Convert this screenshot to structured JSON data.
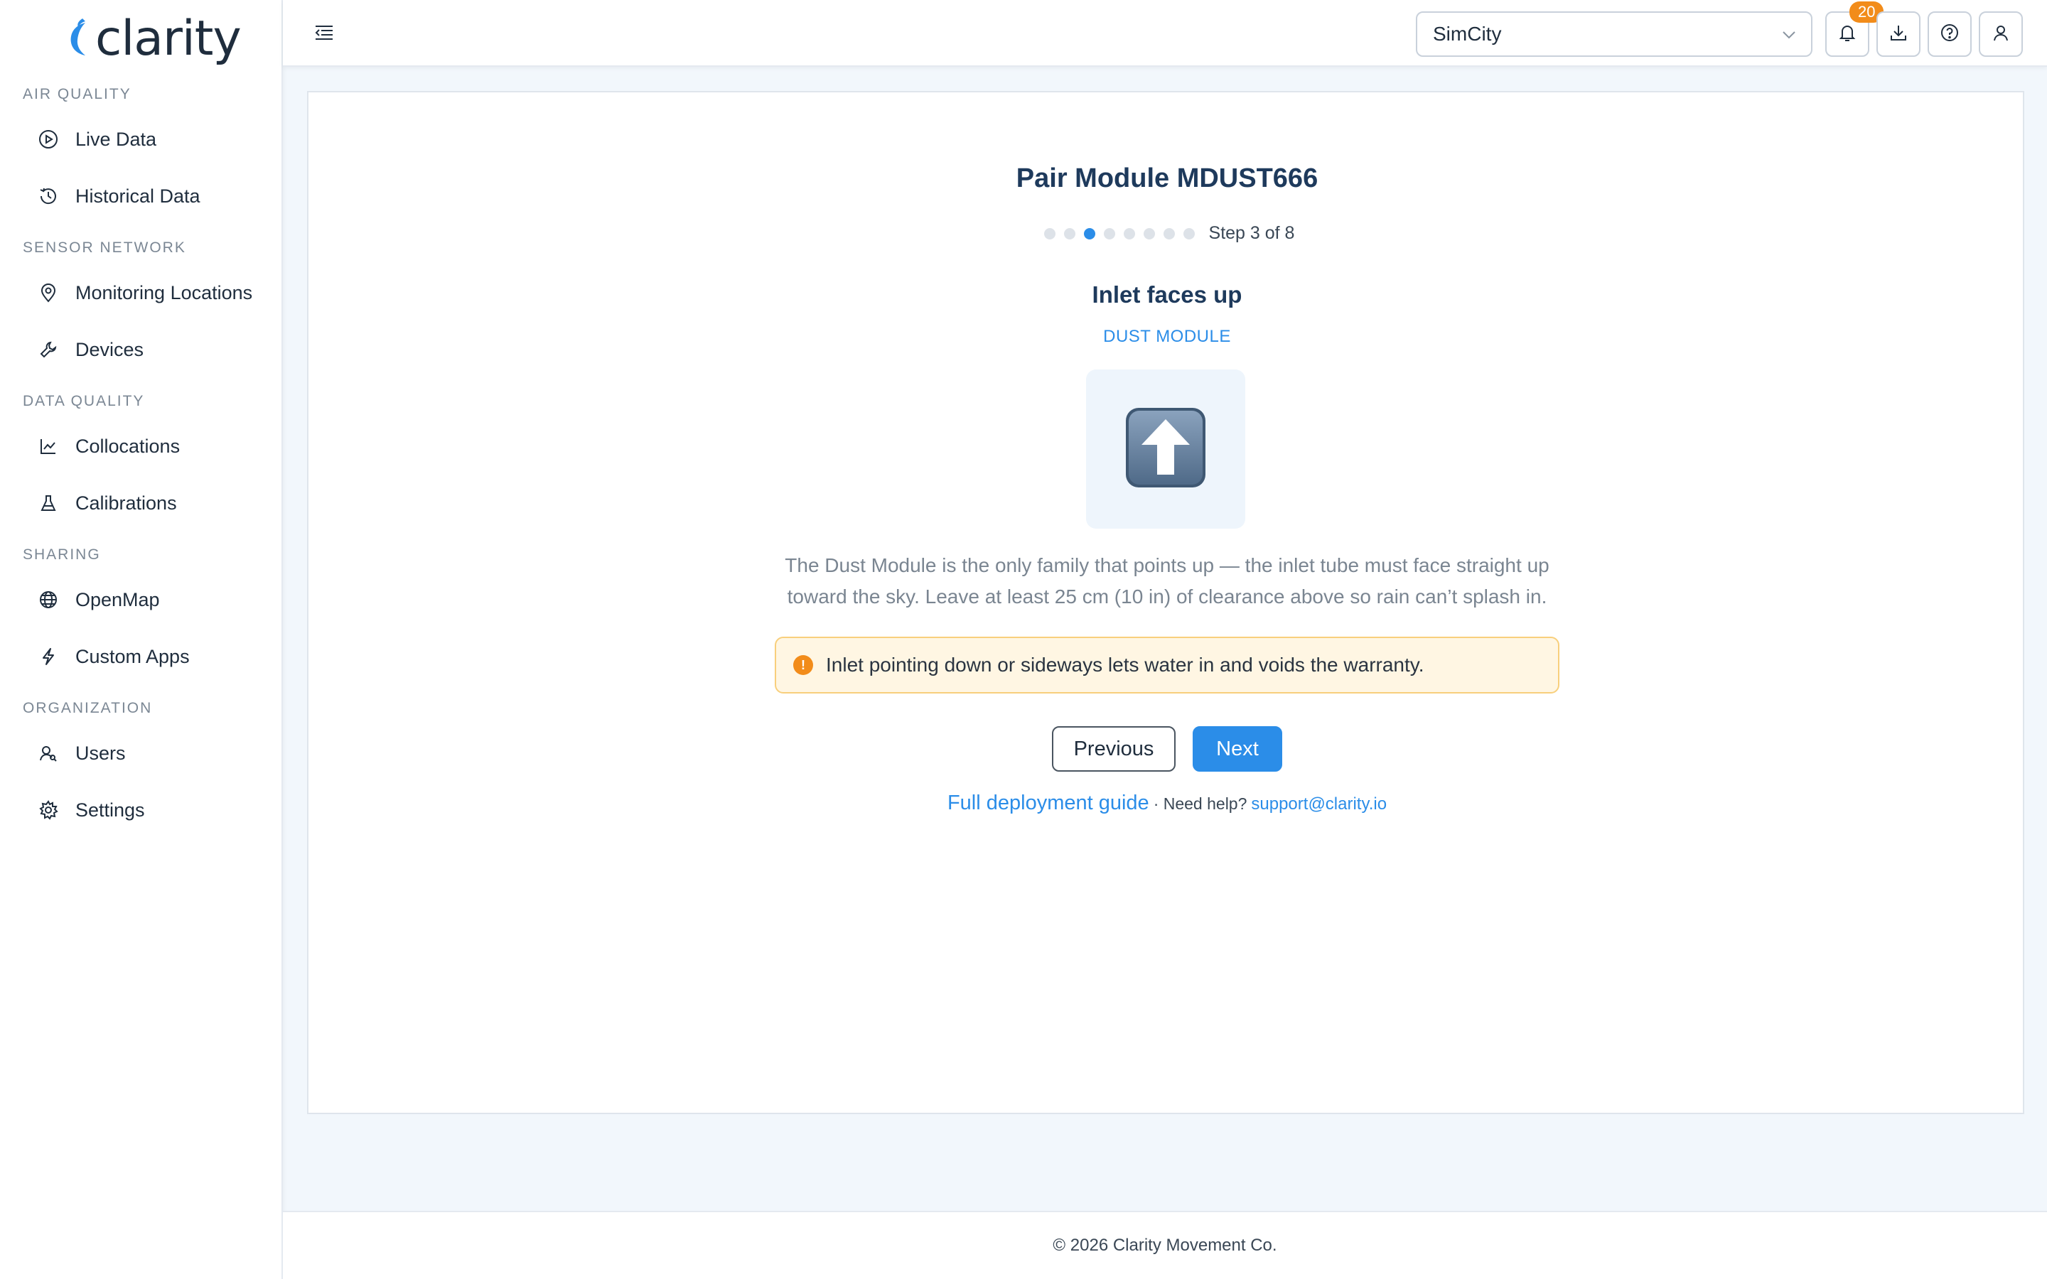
{
  "brand": {
    "name": "clarity",
    "accent": "#2b8de8"
  },
  "sidebar": {
    "sections": [
      {
        "label": "AIR QUALITY",
        "items": [
          {
            "label": "Live Data",
            "icon": "play-circle-icon"
          },
          {
            "label": "Historical Data",
            "icon": "clock-icon"
          }
        ]
      },
      {
        "label": "SENSOR NETWORK",
        "items": [
          {
            "label": "Monitoring Locations",
            "icon": "map-pin-icon"
          },
          {
            "label": "Devices",
            "icon": "wrench-icon"
          }
        ]
      },
      {
        "label": "DATA QUALITY",
        "items": [
          {
            "label": "Collocations",
            "icon": "line-chart-icon"
          },
          {
            "label": "Calibrations",
            "icon": "flask-icon"
          }
        ]
      },
      {
        "label": "SHARING",
        "items": [
          {
            "label": "OpenMap",
            "icon": "globe-icon"
          },
          {
            "label": "Custom Apps",
            "icon": "lightning-icon"
          }
        ]
      },
      {
        "label": "ORGANIZATION",
        "items": [
          {
            "label": "Users",
            "icon": "users-icon"
          },
          {
            "label": "Settings",
            "icon": "gear-icon"
          }
        ]
      }
    ]
  },
  "header": {
    "org_select": {
      "value": "SimCity"
    },
    "notifications_count": "20"
  },
  "wizard": {
    "title": "Pair Module MDUST666",
    "step_current": 3,
    "step_total": 8,
    "step_text": "Step 3 of 8",
    "step_title": "Inlet faces up",
    "step_subtitle": "DUST MODULE",
    "illustration_icon": "up-arrow-icon",
    "description_line1": "The Dust Module is the only family that points up — the inlet tube must face straight up",
    "description_line2": "toward the sky. Leave at least 25 cm (10 in) of clearance above so rain can’t splash in.",
    "warning": "Inlet pointing down or sideways lets water in and voids the warranty.",
    "prev_label": "Previous",
    "next_label": "Next",
    "guide_link": "Full deployment guide",
    "help_text": "· Need help?",
    "support_email": "support@clarity.io"
  },
  "footer": {
    "text": "© 2026 Clarity Movement Co."
  }
}
